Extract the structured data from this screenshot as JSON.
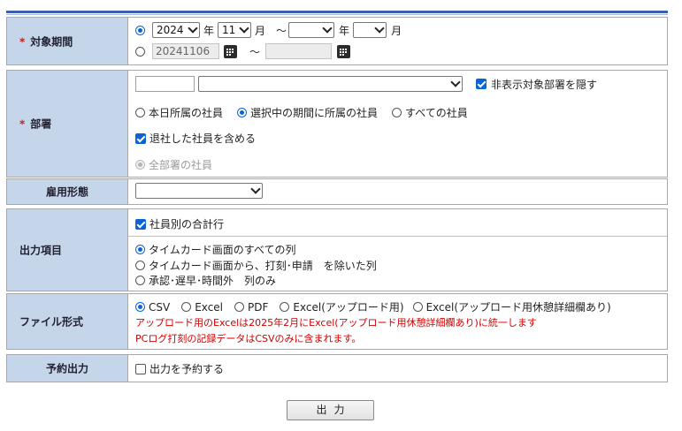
{
  "period": {
    "label": "対象期間",
    "required_mark": "*",
    "year_value": "2024",
    "year_unit": "年",
    "month_value": "11",
    "month_unit": "月",
    "tilde": "～",
    "end_year_value": "",
    "end_month_value": "",
    "date_from": "20241106",
    "date_to": ""
  },
  "department": {
    "label": "部署",
    "required_mark": "*",
    "code_value": "",
    "dept_select_value": "",
    "hide_label": "非表示対象部署を隠す",
    "radio_today": "本日所属の社員",
    "radio_period": "選択中の期間に所属の社員",
    "radio_all": "すべての社員",
    "include_retired": "退社した社員を含める",
    "all_departments": "全部署の社員"
  },
  "employment": {
    "label": "雇用形態",
    "select_value": ""
  },
  "output_items": {
    "label": "出力項目",
    "per_employee_total": "社員別の合計行",
    "radio_all_columns": "タイムカード画面のすべての列",
    "radio_exclude": "タイムカード画面から、打刻･申請　を除いた列",
    "radio_approval": "承認･遅早･時間外　列のみ"
  },
  "file_format": {
    "label": "ファイル形式",
    "csv": "CSV",
    "excel": "Excel",
    "pdf": "PDF",
    "excel_upload": "Excel(アップロード用)",
    "excel_upload_break": "Excel(アップロード用休憩詳細欄あり)",
    "notice1": "アップロード用のExcelは2025年2月にExcel(アップロード用休憩詳細欄あり)に統一します",
    "notice2": "PCログ打刻の記録データはCSVのみに含まれます。"
  },
  "reservation": {
    "label": "予約出力",
    "reserve_output": "出力を予約する"
  },
  "submit": {
    "label": "出力"
  },
  "colors": {
    "label_bg": "#c5d5ea",
    "accent": "#0a64d8",
    "notice": "#d00000",
    "top_rule": "#3b5fae"
  }
}
